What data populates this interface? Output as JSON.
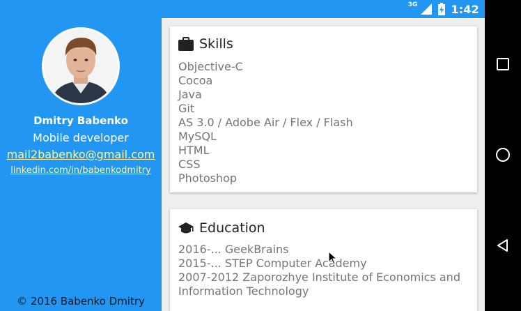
{
  "status_bar": {
    "network": "3G",
    "time": "1:42"
  },
  "profile": {
    "name": "Dmitry Babenko",
    "role": "Mobile developer",
    "email": "mail2babenko@gmail.com",
    "linkedin": "linkedin.com/in/babenkodmitry",
    "copyright": "© 2016 Babenko Dmitry"
  },
  "skills": {
    "title": "Skills",
    "icon": "briefcase-icon",
    "items": [
      "Objective-C",
      "Cocoa",
      "Java",
      "Git",
      "AS 3.0 / Adobe Air / Flex / Flash",
      "MySQL",
      "HTML",
      "CSS",
      "Photoshop"
    ]
  },
  "education": {
    "title": "Education",
    "icon": "graduation-cap-icon",
    "items": [
      "2016-... GeekBrains",
      "2015-... STEP Computer Academy",
      "2007-2012 Zaporozhye Institute of Economics and",
      "Information Technology"
    ]
  },
  "nav": [
    "recents-square-icon",
    "home-circle-icon",
    "back-triangle-icon"
  ],
  "colors": {
    "primary": "#2196f3",
    "link": "#fff59d",
    "background": "#eeeeee"
  }
}
